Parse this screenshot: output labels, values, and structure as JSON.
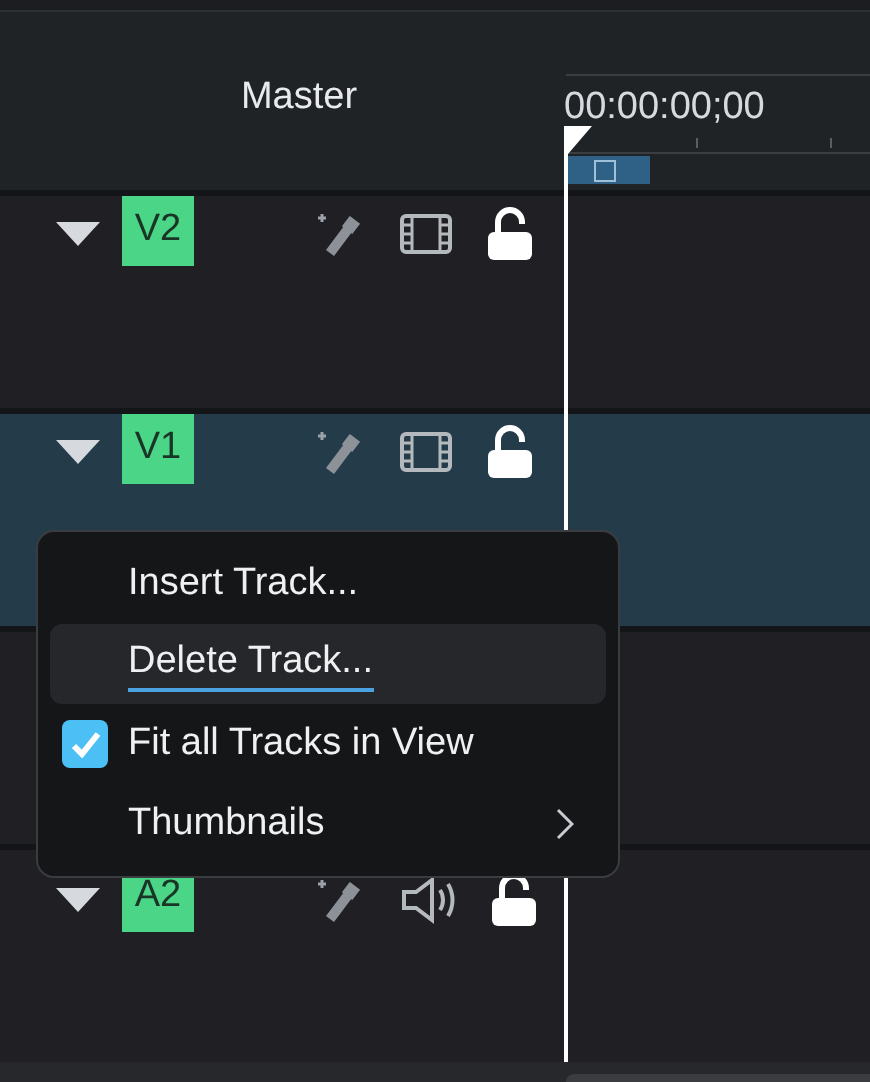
{
  "header": {
    "title": "Master",
    "timecode": "00:00:00;00"
  },
  "tracks": [
    {
      "kind": "video",
      "name": "V2",
      "selected": false
    },
    {
      "kind": "video",
      "name": "V1",
      "selected": true
    },
    {
      "kind": "hidden",
      "selected": false
    },
    {
      "kind": "audio",
      "name": "A2",
      "selected": false
    }
  ],
  "context_menu": {
    "items": [
      {
        "kind": "action",
        "label": "Insert Track...",
        "selected": false
      },
      {
        "kind": "action",
        "label": "Delete Track...",
        "selected": true
      },
      {
        "kind": "check",
        "label": "Fit all Tracks in View",
        "checked": true,
        "selected": false
      },
      {
        "kind": "submenu",
        "label": "Thumbnails",
        "selected": false
      }
    ]
  }
}
